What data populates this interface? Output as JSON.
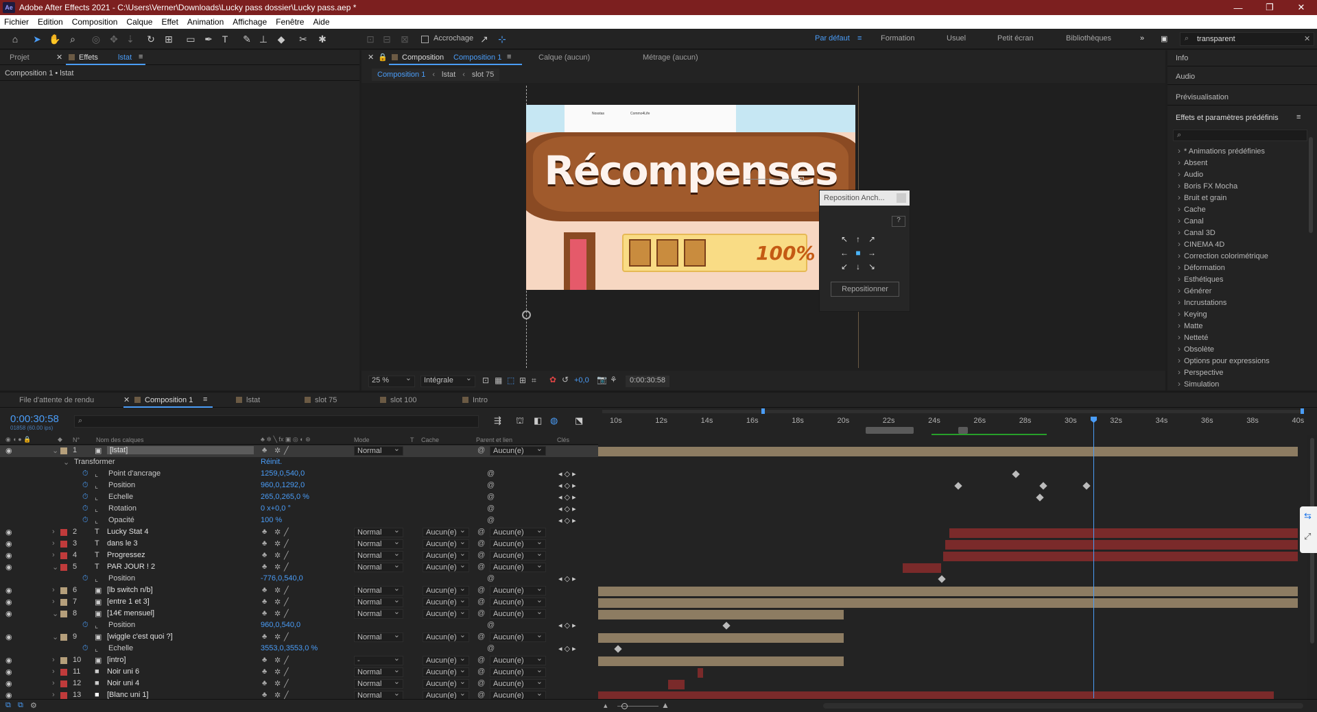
{
  "titlebar": {
    "title": "Adobe After Effects 2021 - C:\\Users\\Verner\\Downloads\\Lucky pass dossier\\Lucky pass.aep *",
    "logo": "Ae",
    "minimize": "—",
    "restore": "❐",
    "close": "✕"
  },
  "menu": [
    "Fichier",
    "Edition",
    "Composition",
    "Calque",
    "Effet",
    "Animation",
    "Affichage",
    "Fenêtre",
    "Aide"
  ],
  "toolbar": {
    "snapping": "Accrochage",
    "workspaces": [
      "Par défaut",
      "Formation",
      "Usuel",
      "Petit écran",
      "Bibliothèques"
    ],
    "more": "»",
    "search_value": "transparent"
  },
  "left_panel": {
    "tab_project": "Projet",
    "tab_effects": "Effets",
    "tab_effects_target": "lstat",
    "breadcrumb": "Composition 1 • lstat"
  },
  "comp_panel": {
    "tab": "Composition",
    "tab_name": "Composition 1",
    "layer_tab": "Calque  (aucun)",
    "footage_tab": "Métrage  (aucun)",
    "crumbs": [
      "Composition 1",
      "lstat",
      "slot 75"
    ],
    "zoom": "25 %",
    "resolution": "Intégrale",
    "exposure": "+0,0",
    "timecode": "0:00:30:58",
    "preview_text": "Récompenses",
    "preview_percent": "100%",
    "preview_row_text": [
      "Nosstas",
      "Commo4Life"
    ]
  },
  "reposition": {
    "title": "Reposition Anch...",
    "help": "?",
    "button": "Repositionner"
  },
  "right_panel": {
    "info": "Info",
    "audio": "Audio",
    "preview": "Prévisualisation",
    "effects_title": "Effets et paramètres prédéfinis",
    "categories": [
      "* Animations prédéfinies",
      "Absent",
      "Audio",
      "Boris FX Mocha",
      "Bruit et grain",
      "Cache",
      "Canal",
      "Canal 3D",
      "CINEMA 4D",
      "Correction colorimétrique",
      "Déformation",
      "Esthétiques",
      "Générer",
      "Incrustations",
      "Keying",
      "Matte",
      "Netteté",
      "Obsolète",
      "Options pour expressions",
      "Perspective",
      "Simulation"
    ]
  },
  "timeline": {
    "tabs": [
      "File d'attente de rendu",
      "Composition 1",
      "lstat",
      "slot 75",
      "slot 100",
      "Intro"
    ],
    "timecode": "0:00:30:58",
    "frames": "01858 (60.00 ips)",
    "headers": {
      "num": "N°",
      "name": "Nom des calques",
      "mode": "Mode",
      "t": "T",
      "cache": "Cache",
      "parent": "Parent et lien",
      "keys": "Clés"
    },
    "ruler": [
      "10s",
      "12s",
      "14s",
      "16s",
      "18s",
      "20s",
      "22s",
      "24s",
      "26s",
      "28s",
      "30s",
      "32s",
      "34s",
      "36s",
      "38s",
      "40s"
    ],
    "layers": [
      {
        "num": "1",
        "name": "[lstat]",
        "kind": "comp",
        "color": "#b59f7b",
        "mode": "Normal",
        "cache": "",
        "parent": "Aucun(e)",
        "selected": true
      },
      {
        "num": "2",
        "name": "Lucky Stat 4",
        "kind": "text",
        "color": "#c03b3b",
        "mode": "Normal",
        "cache": "Aucun(e)",
        "parent": "Aucun(e)"
      },
      {
        "num": "3",
        "name": "dans le 3",
        "kind": "text",
        "color": "#c03b3b",
        "mode": "Normal",
        "cache": "Aucun(e)",
        "parent": "Aucun(e)"
      },
      {
        "num": "4",
        "name": "Progressez",
        "kind": "text",
        "color": "#c03b3b",
        "mode": "Normal",
        "cache": "Aucun(e)",
        "parent": "Aucun(e)"
      },
      {
        "num": "5",
        "name": "PAR JOUR ! 2",
        "kind": "text",
        "color": "#c03b3b",
        "mode": "Normal",
        "cache": "Aucun(e)",
        "parent": "Aucun(e)"
      },
      {
        "num": "6",
        "name": "[lb switch n/b]",
        "kind": "comp",
        "color": "#b59f7b",
        "mode": "Normal",
        "cache": "Aucun(e)",
        "parent": "Aucun(e)"
      },
      {
        "num": "7",
        "name": "[entre 1 et 3]",
        "kind": "comp",
        "color": "#b59f7b",
        "mode": "Normal",
        "cache": "Aucun(e)",
        "parent": "Aucun(e)"
      },
      {
        "num": "8",
        "name": "[14€ mensuel]",
        "kind": "comp",
        "color": "#b59f7b",
        "mode": "Normal",
        "cache": "Aucun(e)",
        "parent": "Aucun(e)"
      },
      {
        "num": "9",
        "name": "[wiggle c'est quoi ?]",
        "kind": "comp",
        "color": "#b59f7b",
        "mode": "Normal",
        "cache": "Aucun(e)",
        "parent": "Aucun(e)"
      },
      {
        "num": "10",
        "name": "[intro]",
        "kind": "comp",
        "color": "#b59f7b",
        "mode": "-",
        "cache": "Aucun(e)",
        "parent": "Aucun(e)"
      },
      {
        "num": "11",
        "name": "Noir uni 6",
        "kind": "solid",
        "color": "#c03b3b",
        "mode": "Normal",
        "cache": "Aucun(e)",
        "parent": "Aucun(e)"
      },
      {
        "num": "12",
        "name": "Noir uni 4",
        "kind": "solid",
        "color": "#c03b3b",
        "mode": "Normal",
        "cache": "Aucun(e)",
        "parent": "Aucun(e)"
      },
      {
        "num": "13",
        "name": "[Blanc uni 1]",
        "kind": "solid",
        "color": "#c03b3b",
        "mode": "Normal",
        "cache": "Aucun(e)",
        "parent": "Aucun(e)"
      }
    ],
    "transform": {
      "label": "Transformer",
      "reset": "Réinit.",
      "props": [
        {
          "name": "Point d'ancrage",
          "value": "1259,0,540,0"
        },
        {
          "name": "Position",
          "value": "960,0,1292,0"
        },
        {
          "name": "Echelle",
          "value": "265,0,265,0 %"
        },
        {
          "name": "Rotation",
          "value": "0 x+0,0 °"
        },
        {
          "name": "Opacité",
          "value": "100 %"
        }
      ]
    },
    "sub_props": {
      "layer5_position": {
        "name": "Position",
        "value": "-776,0,540,0"
      },
      "layer8_position": {
        "name": "Position",
        "value": "960,0,540,0"
      },
      "layer9_scale": {
        "name": "Echelle",
        "value": "3553,0,3553,0 %"
      }
    }
  }
}
